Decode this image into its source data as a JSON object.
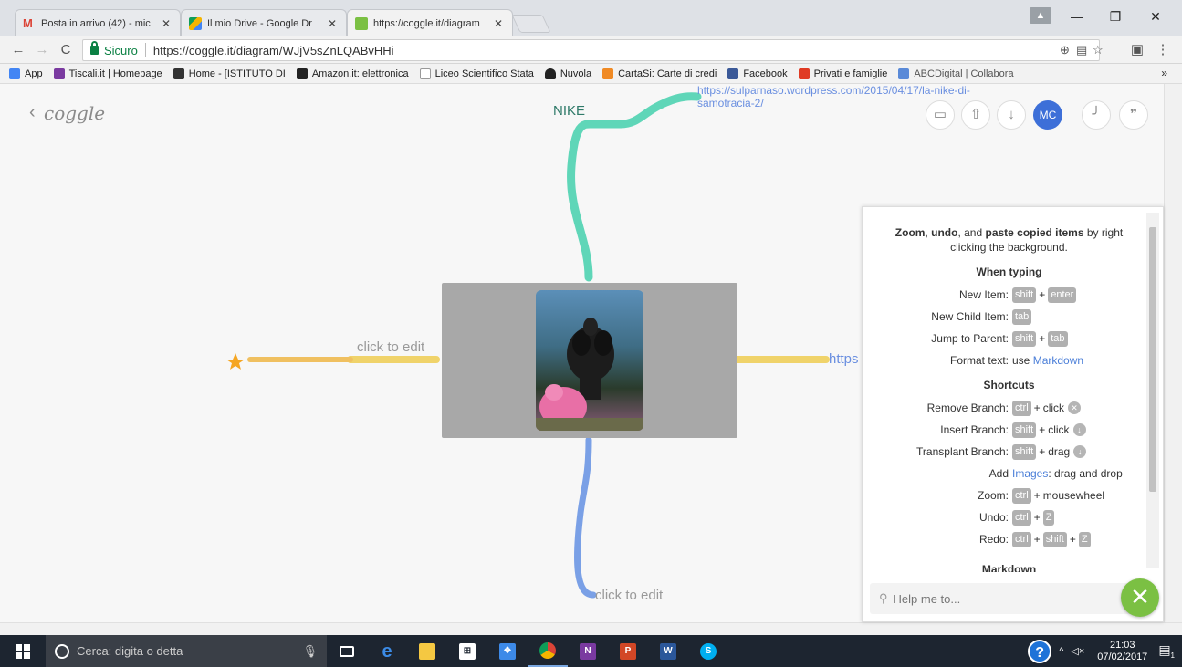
{
  "browser": {
    "tabs": [
      {
        "title": "Posta in arrivo (42) - mic",
        "favicon_color": "#db4437",
        "active": false
      },
      {
        "title": "Il mio Drive - Google Dr",
        "favicon_color": "#f4b400",
        "active": false
      },
      {
        "title": "https://coggle.it/diagram",
        "favicon_color": "#7bc043",
        "active": true
      }
    ],
    "secure_label": "Sicuro",
    "url": "https://coggle.it/diagram/WJjV5sZnLQABvHHi",
    "bookmarks": [
      {
        "label": "App",
        "color": "#4285f4"
      },
      {
        "label": "Tiscali.it | Homepage",
        "color": "#7a3aa0"
      },
      {
        "label": "Home - [ISTITUTO DI",
        "color": "#333333"
      },
      {
        "label": "Amazon.it: elettronica",
        "color": "#222222"
      },
      {
        "label": "Liceo Scientifico Stata",
        "color": "#999999"
      },
      {
        "label": "Nuvola",
        "color": "#222222"
      },
      {
        "label": "CartaSi: Carte di credi",
        "color": "#f08a24"
      },
      {
        "label": "Facebook",
        "color": "#3b5998"
      },
      {
        "label": "Privati e famiglie",
        "color": "#e03b24"
      },
      {
        "label": "ABCDigital | Collabora",
        "color": "#5a8ad8"
      }
    ],
    "bookmarks_more": "»"
  },
  "canvas": {
    "logo": "coggle",
    "back": "<",
    "nike_label": "NIKE",
    "nike_link": "https://sulparnaso.wordpress.com/2015/04/17/la-nike-di-samotracia-2/",
    "left_label": "click to edit",
    "bottom_label": "click to edit",
    "right_link": "https",
    "avatar_initials": "MC",
    "colors": {
      "teal_branch": "#5fd6b8",
      "yellow_branch": "#f0d36a",
      "orange_branch": "#f0c060",
      "blue_branch": "#7aa0e6",
      "star": "#f5a623",
      "center_node": "#a8a8a8"
    }
  },
  "help": {
    "intro_parts": [
      "Zoom",
      ", ",
      "undo",
      ", and ",
      "paste copied items",
      " by right clicking the background."
    ],
    "section_typing": "When typing",
    "new_item": "New Item:",
    "new_child": "New Child Item:",
    "jump_parent": "Jump to Parent:",
    "format_text": "Format text:",
    "format_use": "use",
    "markdown_link": "Markdown",
    "section_shortcuts": "Shortcuts",
    "remove_branch": "Remove Branch:",
    "insert_branch": "Insert Branch:",
    "transplant_branch": "Transplant Branch:",
    "add": "Add",
    "images_link": "Images",
    "add_suffix": ": drag and drop",
    "zoom": "Zoom:",
    "undo": "Undo:",
    "redo": "Redo:",
    "key_shift": "shift",
    "key_enter": "enter",
    "key_tab": "tab",
    "key_ctrl": "ctrl",
    "key_z": "Z",
    "plus": "+",
    "click": "click",
    "drag": "drag",
    "mousewheel": "mousewheel",
    "section_markdown": "Markdown",
    "search_placeholder": "Help me to..."
  },
  "taskbar": {
    "search_placeholder": "Cerca: digita o detta",
    "time": "21:03",
    "date": "07/02/2017",
    "notification_count": "1"
  }
}
